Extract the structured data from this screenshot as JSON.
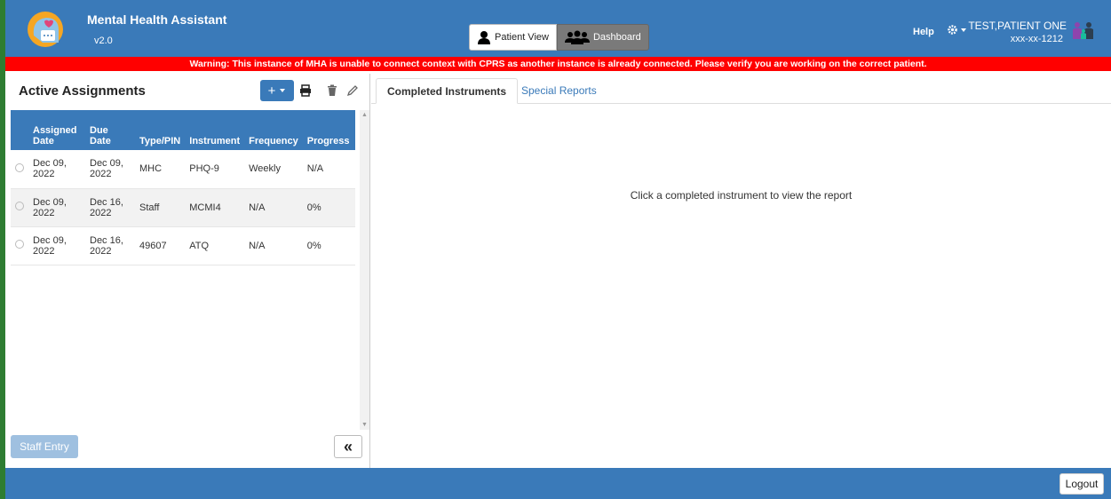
{
  "header": {
    "title": "Mental Health Assistant",
    "version": "v2.0",
    "patient_view_label": "Patient View",
    "dashboard_label": "Dashboard",
    "help_label": "Help",
    "patient_name": "TEST,PATIENT ONE",
    "patient_ssn": "xxx-xx-1212"
  },
  "warning": "Warning: This instance of MHA is unable to connect context with CPRS as another instance is already connected. Please verify you are working on the correct patient.",
  "left": {
    "title": "Active Assignments",
    "add_label": "+",
    "columns": [
      "Assigned Date",
      "Due Date",
      "Type/PIN",
      "Instrument",
      "Frequency",
      "Progress"
    ],
    "rows": [
      {
        "assigned": "Dec 09, 2022",
        "due": "Dec 09, 2022",
        "type": "MHC",
        "instrument": "PHQ-9",
        "frequency": "Weekly",
        "progress": "N/A"
      },
      {
        "assigned": "Dec 09, 2022",
        "due": "Dec 16, 2022",
        "type": "Staff",
        "instrument": "MCMI4",
        "frequency": "N/A",
        "progress": "0%"
      },
      {
        "assigned": "Dec 09, 2022",
        "due": "Dec 16, 2022",
        "type": "49607",
        "instrument": "ATQ",
        "frequency": "N/A",
        "progress": "0%"
      }
    ],
    "staff_entry_label": "Staff Entry",
    "collapse_label": "«"
  },
  "right": {
    "tabs": [
      "Completed Instruments",
      "Special Reports"
    ],
    "empty_message": "Click a completed instrument to view the report"
  },
  "footer": {
    "logout_label": "Logout"
  },
  "colors": {
    "primary": "#3a7ab9",
    "warning": "#ff0000"
  }
}
